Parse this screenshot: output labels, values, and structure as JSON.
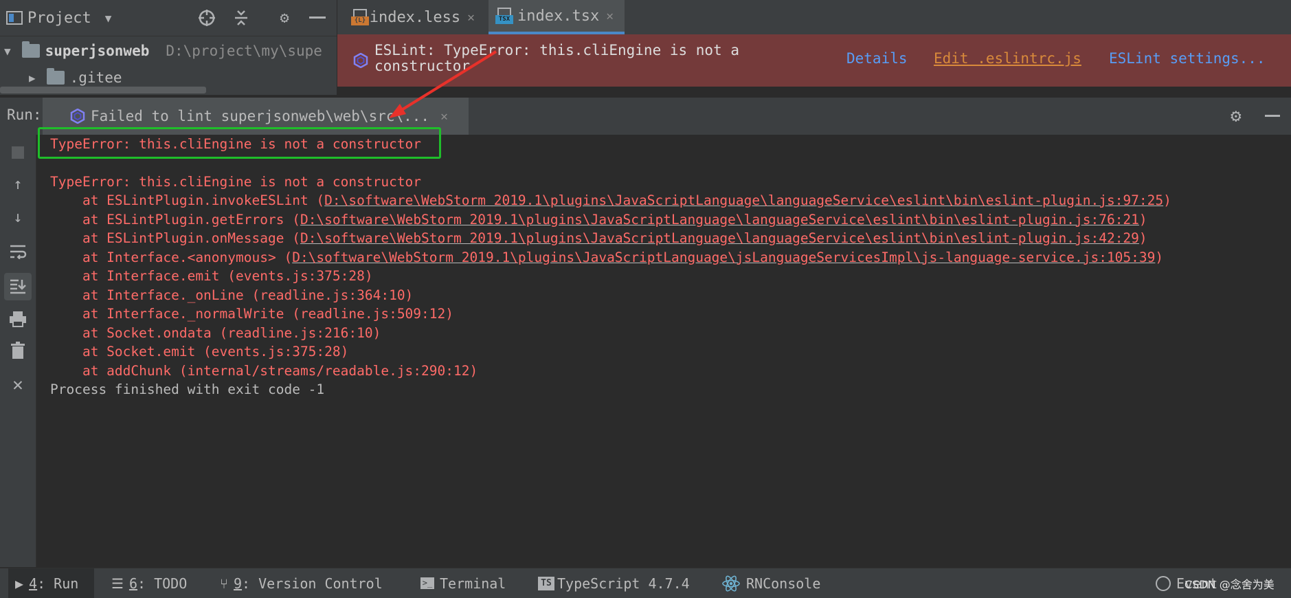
{
  "project": {
    "title": "Project",
    "tree": [
      {
        "name": "superjsonweb",
        "path": "D:\\project\\my\\supe"
      },
      {
        "name": ".gitee"
      }
    ]
  },
  "tabs": [
    {
      "label": "index.less",
      "icon": "less-file-icon",
      "badge": "{L}"
    },
    {
      "label": "index.tsx",
      "icon": "tsx-file-icon",
      "badge": "TSX"
    }
  ],
  "banner": {
    "message_line1": "ESLint: TypeError: this.cliEngine is not a",
    "message_line2": "constructor",
    "links": {
      "details": "Details",
      "edit_config": "Edit .eslintrc.js",
      "settings": "ESLint settings..."
    },
    "color": "#743a3a"
  },
  "run": {
    "label": "Run:",
    "tab_title": "Failed to lint superjsonweb\\web\\src\\..."
  },
  "console": {
    "highlighted_error": "TypeError: this.cliEngine is not a constructor",
    "error_title": "TypeError: this.cliEngine is not a constructor",
    "stack": [
      {
        "prefix": "    at ESLintPlugin.invokeESLint (",
        "link": "D:\\software\\WebStorm 2019.1\\plugins\\JavaScriptLanguage\\languageService\\eslint\\bin\\eslint-plugin.js:97:25",
        "suffix": ")"
      },
      {
        "prefix": "    at ESLintPlugin.getErrors (",
        "link": "D:\\software\\WebStorm 2019.1\\plugins\\JavaScriptLanguage\\languageService\\eslint\\bin\\eslint-plugin.js:76:21",
        "suffix": ")"
      },
      {
        "prefix": "    at ESLintPlugin.onMessage (",
        "link": "D:\\software\\WebStorm 2019.1\\plugins\\JavaScriptLanguage\\languageService\\eslint\\bin\\eslint-plugin.js:42:29",
        "suffix": ")"
      },
      {
        "prefix": "    at Interface.<anonymous> (",
        "link": "D:\\software\\WebStorm 2019.1\\plugins\\JavaScriptLanguage\\jsLanguageServicesImpl\\js-language-service.js:105:39",
        "suffix": ")"
      },
      {
        "prefix": "    at Interface.emit (events.js:375:28)",
        "link": "",
        "suffix": ""
      },
      {
        "prefix": "    at Interface._onLine (readline.js:364:10)",
        "link": "",
        "suffix": ""
      },
      {
        "prefix": "    at Interface._normalWrite (readline.js:509:12)",
        "link": "",
        "suffix": ""
      },
      {
        "prefix": "    at Socket.ondata (readline.js:216:10)",
        "link": "",
        "suffix": ""
      },
      {
        "prefix": "    at Socket.emit (events.js:375:28)",
        "link": "",
        "suffix": ""
      },
      {
        "prefix": "    at addChunk (internal/streams/readable.js:290:12)",
        "link": "",
        "suffix": ""
      }
    ],
    "exit_line": "Process finished with exit code -1",
    "error_color": "#ff6b68"
  },
  "statusbar": {
    "items": [
      {
        "num": "4",
        "label": ": Run",
        "icon": "play-icon"
      },
      {
        "num": "6",
        "label": ": TODO",
        "icon": "list-icon"
      },
      {
        "num": "9",
        "label": ": Version Control",
        "icon": "vcs-icon"
      },
      {
        "num": "",
        "label": "Terminal",
        "icon": "terminal-icon"
      },
      {
        "num": "",
        "label": "TypeScript 4.7.4",
        "icon": "typescript-icon",
        "badge": "TS"
      },
      {
        "num": "",
        "label": "RNConsole",
        "icon": "react-icon"
      }
    ],
    "event_log": "Event",
    "watermark": "CSDN @念舍为美"
  }
}
